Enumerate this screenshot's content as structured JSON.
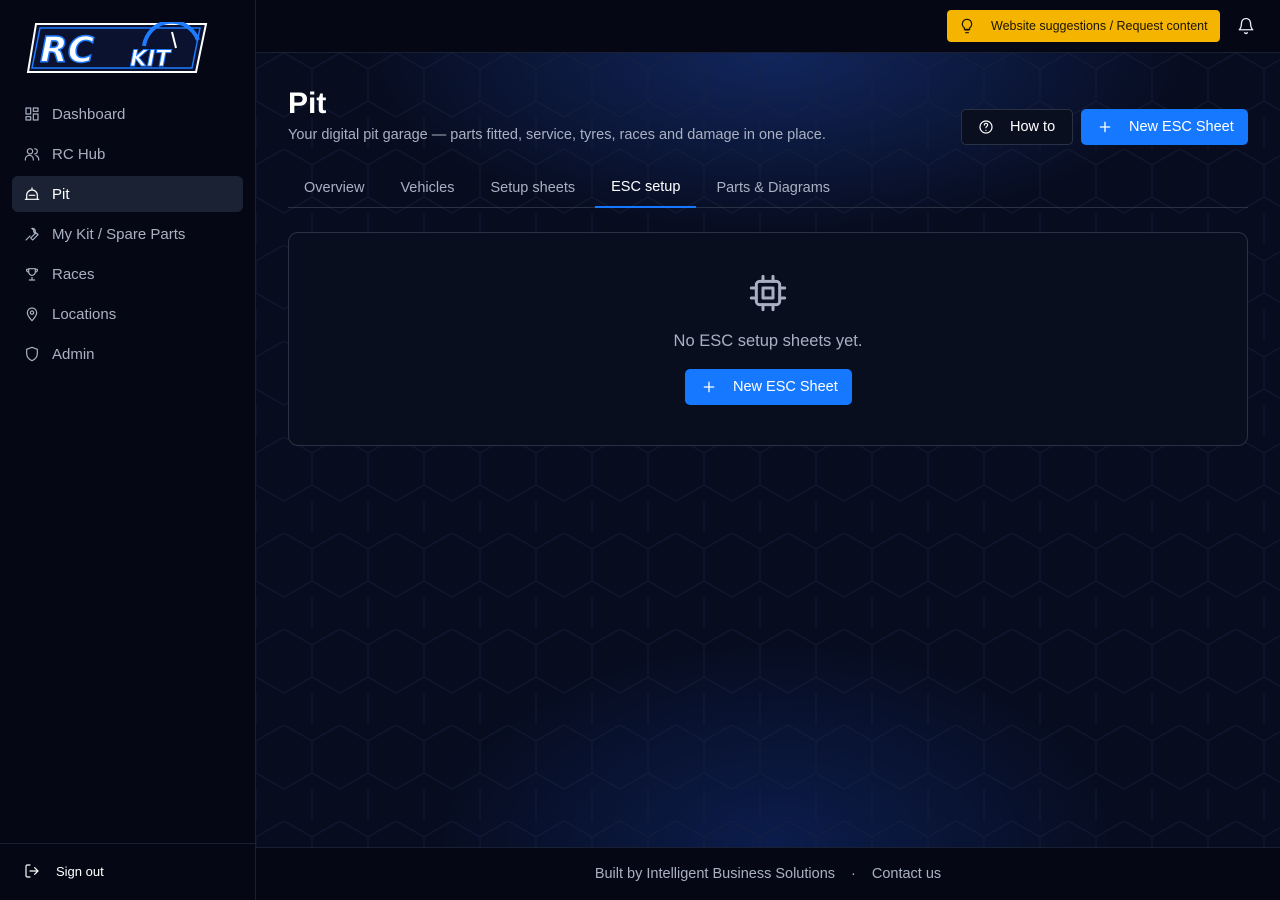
{
  "app": {
    "logo_text": "RC KIT"
  },
  "sidebar": {
    "items": [
      {
        "label": "Dashboard",
        "icon": "dashboard-icon"
      },
      {
        "label": "RC Hub",
        "icon": "users-icon"
      },
      {
        "label": "Pit",
        "icon": "pit-icon",
        "active": true
      },
      {
        "label": "My Kit / Spare Parts",
        "icon": "wrench-icon"
      },
      {
        "label": "Races",
        "icon": "trophy-icon"
      },
      {
        "label": "Locations",
        "icon": "map-pin-icon"
      },
      {
        "label": "Admin",
        "icon": "shield-icon"
      }
    ],
    "signout_label": "Sign out"
  },
  "topbar": {
    "suggest_label": "Website suggestions / Request content",
    "suggest_icon": "lightbulb-icon",
    "bell_icon": "bell-icon"
  },
  "page": {
    "title": "Pit",
    "subtitle": "Your digital pit garage — parts fitted, service, tyres, races and damage in one place.",
    "howto_label": "How to",
    "new_label": "New ESC Sheet"
  },
  "tabs": [
    {
      "label": "Overview"
    },
    {
      "label": "Vehicles"
    },
    {
      "label": "Setup sheets"
    },
    {
      "label": "ESC setup",
      "active": true
    },
    {
      "label": "Parts & Diagrams"
    }
  ],
  "empty_state": {
    "icon": "chip-icon",
    "message": "No ESC setup sheets yet.",
    "button_label": "New ESC Sheet"
  },
  "footer": {
    "built_by": "Built by Intelligent Business Solutions",
    "separator": "·",
    "contact": "Contact us"
  },
  "colors": {
    "accent": "#1677ff",
    "suggest_bg": "#f5b400",
    "background": "#070b1a"
  }
}
